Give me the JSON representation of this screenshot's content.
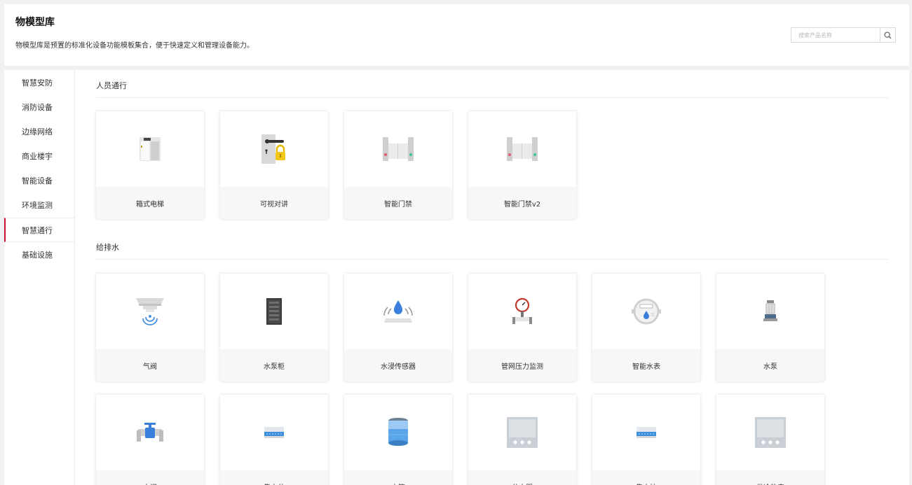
{
  "header": {
    "title": "物模型库",
    "description": "物模型库是预置的标准化设备功能模板集合，便于快速定义和管理设备能力。",
    "search_placeholder": "搜索产品名称"
  },
  "sidebar": {
    "items": [
      {
        "label": "智慧安防",
        "active": false
      },
      {
        "label": "消防设备",
        "active": false
      },
      {
        "label": "边缘网络",
        "active": false
      },
      {
        "label": "商业楼宇",
        "active": false
      },
      {
        "label": "智能设备",
        "active": false
      },
      {
        "label": "环境监测",
        "active": false
      },
      {
        "label": "智慧通行",
        "active": true
      },
      {
        "label": "基础设施",
        "active": false
      }
    ]
  },
  "sections": [
    {
      "title": "人员通行",
      "cards": [
        {
          "label": "箱式电梯",
          "icon": "box-elevator-icon"
        },
        {
          "label": "可视对讲",
          "icon": "door-lock-intercom-icon"
        },
        {
          "label": "智能门禁",
          "icon": "turnstile-gate-icon"
        },
        {
          "label": "智能门禁v2",
          "icon": "turnstile-gate-icon"
        }
      ]
    },
    {
      "title": "给排水",
      "cards": [
        {
          "label": "气阀",
          "icon": "gas-valve-icon"
        },
        {
          "label": "水泵柜",
          "icon": "pump-cabinet-icon"
        },
        {
          "label": "水浸传感器",
          "icon": "water-leak-sensor-icon"
        },
        {
          "label": "管网压力监测",
          "icon": "pressure-gauge-icon"
        },
        {
          "label": "智能水表",
          "icon": "water-meter-icon"
        },
        {
          "label": "水泵",
          "icon": "water-pump-icon"
        },
        {
          "label": "水阀",
          "icon": "water-valve-icon"
        },
        {
          "label": "集水井",
          "icon": "collector-icon"
        },
        {
          "label": "水箱",
          "icon": "water-tank-icon"
        },
        {
          "label": "分水器",
          "icon": "control-panel-icon"
        },
        {
          "label": "集水坑",
          "icon": "collector-icon"
        },
        {
          "label": "供冷热表",
          "icon": "control-panel-icon"
        }
      ]
    }
  ],
  "colors": {
    "accent": "#c8102e",
    "background": "#f0f1f3",
    "card_label_bg": "#f7f7f7"
  }
}
